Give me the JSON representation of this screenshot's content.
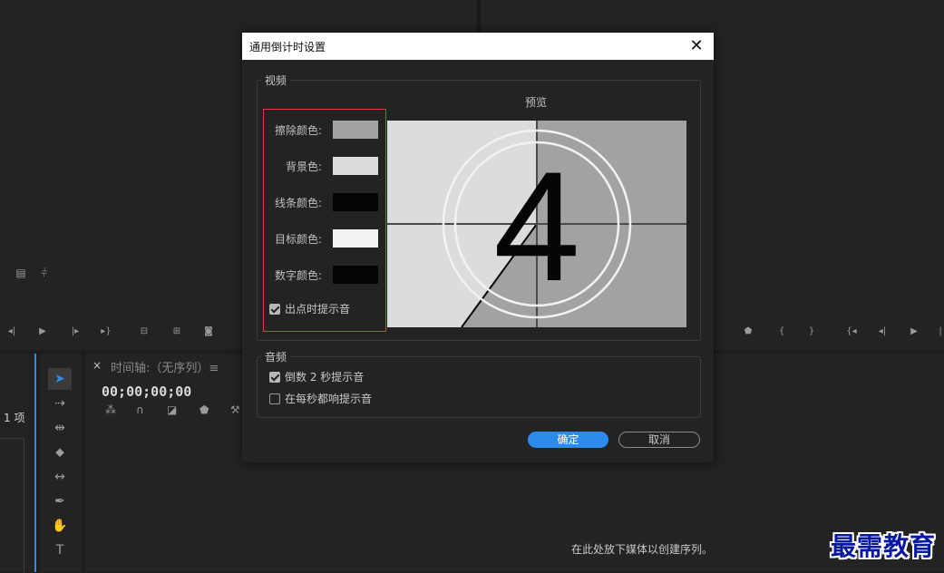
{
  "dialog": {
    "title": "通用倒计时设置",
    "video": {
      "group_label": "视频",
      "preview_label": "预览",
      "preview_number": "4",
      "colors": [
        {
          "label": "擦除颜色:",
          "color": "#a2a2a2"
        },
        {
          "label": "背景色:",
          "color": "#dcdcdc"
        },
        {
          "label": "线条颜色:",
          "color": "#050505"
        },
        {
          "label": "目标颜色:",
          "color": "#f2f2f2"
        },
        {
          "label": "数字颜色:",
          "color": "#050505"
        }
      ],
      "cue_at_out": {
        "label": "出点时提示音",
        "checked": true
      }
    },
    "audio": {
      "group_label": "音频",
      "options": [
        {
          "label": "倒数 2 秒提示音",
          "checked": true
        },
        {
          "label": "在每秒都响提示音",
          "checked": false
        }
      ]
    },
    "ok_label": "确定",
    "cancel_label": "取消"
  },
  "timeline": {
    "tab_title": "时间轴:（无序列）≡",
    "timecode": "00;00;00;00",
    "drop_hint": "在此处放下媒体以创建序列。"
  },
  "project": {
    "items_count": "1 项"
  },
  "watermark": "最需教育",
  "colors": {
    "accent": "#2d8ceb",
    "highlight_border": "#e0383f"
  }
}
